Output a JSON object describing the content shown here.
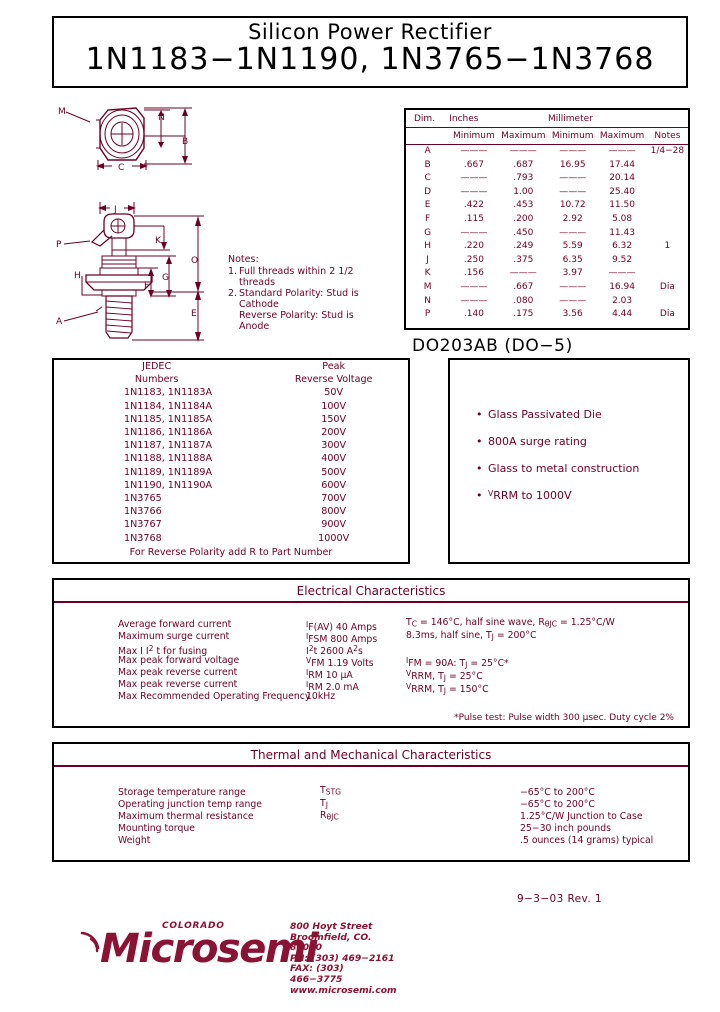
{
  "title": {
    "subtitle": "Silicon Power Rectifier",
    "main": "1N1183−1N1190, 1N3765−1N3768"
  },
  "package": {
    "label": "DO203AB (DO−5)"
  },
  "dimension_table": {
    "header_top": {
      "dim": "Dim.",
      "inches": "Inches",
      "millimeter": "Millimeter"
    },
    "header_sub": {
      "min_in": "Minimum",
      "max_in": "Maximum",
      "min_mm": "Minimum",
      "max_mm": "Maximum",
      "notes": "Notes"
    },
    "rows": [
      {
        "dim": "A",
        "min_in": "———",
        "max_in": "———",
        "min_mm": "———",
        "max_mm": "———",
        "notes": "1/4−28"
      },
      {
        "dim": "B",
        "min_in": ".667",
        "max_in": ".687",
        "min_mm": "16.95",
        "max_mm": "17.44",
        "notes": ""
      },
      {
        "dim": "C",
        "min_in": "———",
        "max_in": ".793",
        "min_mm": "———",
        "max_mm": "20.14",
        "notes": ""
      },
      {
        "dim": "D",
        "min_in": "———",
        "max_in": "1.00",
        "min_mm": "———",
        "max_mm": "25.40",
        "notes": ""
      },
      {
        "dim": "E",
        "min_in": ".422",
        "max_in": ".453",
        "min_mm": "10.72",
        "max_mm": "11.50",
        "notes": ""
      },
      {
        "dim": "F",
        "min_in": ".115",
        "max_in": ".200",
        "min_mm": "2.92",
        "max_mm": "5.08",
        "notes": ""
      },
      {
        "dim": "G",
        "min_in": "———",
        "max_in": ".450",
        "min_mm": "———",
        "max_mm": "11.43",
        "notes": ""
      },
      {
        "dim": "H",
        "min_in": ".220",
        "max_in": ".249",
        "min_mm": "5.59",
        "max_mm": "6.32",
        "notes": "1"
      },
      {
        "dim": "J",
        "min_in": ".250",
        "max_in": ".375",
        "min_mm": "6.35",
        "max_mm": "9.52",
        "notes": ""
      },
      {
        "dim": "K",
        "min_in": ".156",
        "max_in": "———",
        "min_mm": "3.97",
        "max_mm": "———",
        "notes": ""
      },
      {
        "dim": "M",
        "min_in": "———",
        "max_in": ".667",
        "min_mm": "———",
        "max_mm": "16.94",
        "notes": "Dia"
      },
      {
        "dim": "N",
        "min_in": "———",
        "max_in": ".080",
        "min_mm": "———",
        "max_mm": "2.03",
        "notes": ""
      },
      {
        "dim": "P",
        "min_in": ".140",
        "max_in": ".175",
        "min_mm": "3.56",
        "max_mm": "4.44",
        "notes": "Dia"
      }
    ]
  },
  "drawing": {
    "callouts": [
      "M",
      "N",
      "B",
      "C",
      "J",
      "P",
      "K",
      "O",
      "H",
      "G",
      "F",
      "E",
      "A"
    ]
  },
  "notes": {
    "heading": "Notes:",
    "items": [
      {
        "num": "1.",
        "text": "Full threads within 2 1/2 threads"
      },
      {
        "num": "2.",
        "text": "Standard Polarity: Stud is Cathode Reverse Polarity: Stud is Anode"
      }
    ],
    "item1_line1": "Full  threads  within  2 1/2",
    "item1_line2": "threads",
    "item2_line1": "Standard Polarity: Stud is",
    "item2_line2": "Cathode",
    "item2_line3": "Reverse Polarity: Stud is",
    "item2_line4": "Anode"
  },
  "jedec": {
    "header_left_line1": "JEDEC",
    "header_left_line2": "Numbers",
    "header_right_line1": "Peak",
    "header_right_line2": "Reverse  Voltage",
    "rows": [
      {
        "numbers": "1N1183, 1N1183A",
        "voltage": "50V"
      },
      {
        "numbers": "1N1184, 1N1184A",
        "voltage": "100V"
      },
      {
        "numbers": "1N1185, 1N1185A",
        "voltage": "150V"
      },
      {
        "numbers": "1N1186, 1N1186A",
        "voltage": "200V"
      },
      {
        "numbers": "1N1187, 1N1187A",
        "voltage": "300V"
      },
      {
        "numbers": "1N1188, 1N1188A",
        "voltage": "400V"
      },
      {
        "numbers": "1N1189, 1N1189A",
        "voltage": "500V"
      },
      {
        "numbers": "1N1190, 1N1190A",
        "voltage": "600V"
      },
      {
        "numbers": "1N3765",
        "voltage": "700V"
      },
      {
        "numbers": "1N3766",
        "voltage": "800V"
      },
      {
        "numbers": "1N3767",
        "voltage": "900V"
      },
      {
        "numbers": "1N3768",
        "voltage": "1000V"
      }
    ],
    "footnote": "For Reverse Polarity add R to Part Number"
  },
  "features": {
    "items": [
      "Glass Passivated Die",
      "800A surge rating",
      "Glass to metal construction",
      "V<sub>RRM</sub> to 1000V"
    ],
    "item1": "Glass Passivated Die",
    "item2": "800A surge rating",
    "item3": "Glass to metal construction",
    "item4_v": "V",
    "item4_sub": "RRM",
    "item4_rest": " to 1000V"
  },
  "electrical": {
    "title": "Electrical  Characteristics",
    "rows": [
      {
        "label": "Average forward current",
        "symbol": "IF(AV) 40 Amps",
        "condition": "TC = 146°C, half sine wave, RθJC = 1.25°C/W"
      },
      {
        "label": "Maximum surge current",
        "symbol": "IFSM  800 Amps",
        "condition": "8.3ms, half sine, TJ = 200°C"
      },
      {
        "label": "Max I 2 t for fusing",
        "symbol": "I2t 2600 A2s",
        "condition": ""
      },
      {
        "label": "Max peak forward voltage",
        "symbol": "VFM 1.19 Volts",
        "condition": "IFM = 90A: TJ = 25°C*"
      },
      {
        "label": "Max peak reverse current",
        "symbol": "IRM 10 µA",
        "condition": "VRRM, TJ = 25°C"
      },
      {
        "label": "Max peak reverse current",
        "symbol": "IRM 2.0 mA",
        "condition": "VRRM, TJ = 150°C"
      },
      {
        "label": "Max Recommended Operating Frequency",
        "symbol": "10kHz",
        "condition": ""
      }
    ],
    "labels": {
      "r1": "Average forward current",
      "r2": "Maximum surge current",
      "r3a": "Max I",
      "r3b": "t for fusing",
      "r4": "Max peak forward voltage",
      "r5": "Max peak reverse current",
      "r6": "Max peak reverse current",
      "r7": "Max Recommended Operating Frequency"
    },
    "symbols": {
      "s1_pre": "I",
      "s1_rest": "F(AV) 40 Amps",
      "s2_pre": "I",
      "s2_sub": "FSM",
      "s2_rest": "  800 Amps",
      "s3_pre": "I",
      "s3_sup": "2",
      "s3_mid": "t 2600 A",
      "s3_sup2": "2",
      "s3_end": "s",
      "s4_pre": "V",
      "s4_sub": "FM",
      "s4_rest": " 1.19 Volts",
      "s5_pre": "I",
      "s5_sub": "RM",
      "s5_rest": " 10 µA",
      "s6_pre": "I",
      "s6_sub": "RM",
      "s6_rest": " 2.0 mA",
      "s7": "10kHz"
    },
    "conditions": {
      "c1_a": "T",
      "c1_sub": "C",
      "c1_b": " = 146°C, half sine wave, R",
      "c1_sub2": "θJC",
      "c1_c": " = 1.25°C/W",
      "c2_a": "8.3ms, half sine, ",
      "c2_t": "T",
      "c2_sub": "J",
      "c2_b": " = 200°C",
      "c4_a": "I",
      "c4_sub": "FM",
      "c4_b": " = 90A: ",
      "c4_t": "T",
      "c4_sub2": "J",
      "c4_c": " = 25°C*",
      "c5_a": "V",
      "c5_sub": "RRM",
      "c5_b": ", ",
      "c5_t": "T",
      "c5_sub2": "J",
      "c5_c": " = 25°C",
      "c6_a": "V",
      "c6_sub": "RRM",
      "c6_b": ", ",
      "c6_t": "T",
      "c6_sub2": "J",
      "c6_c": " = 150°C"
    },
    "pulse_note": "*Pulse test: Pulse width 300 µsec. Duty cycle 2%"
  },
  "thermal": {
    "title": "Thermal  and  Mechanical  Characteristics",
    "rows": [
      {
        "label": "Storage temperature range",
        "symbol": "TSTG",
        "value": "−65°C to 200°C"
      },
      {
        "label": "Operating junction temp range",
        "symbol": "TJ",
        "value": "−65°C to 200°C"
      },
      {
        "label": "Maximum thermal resistance",
        "symbol": "RθJC",
        "value": "1.25°C/W Junction to Case"
      },
      {
        "label": "Mounting torque",
        "symbol": "",
        "value": "25−30 inch pounds"
      },
      {
        "label": "Weight",
        "symbol": "",
        "value": ".5 ounces (14 grams) typical"
      }
    ],
    "symbols": {
      "s1_pre": "T",
      "s1_sub": "STG",
      "s2_pre": "T",
      "s2_sub": "J",
      "s3_pre": "R",
      "s3_sub": "θJC"
    }
  },
  "footer": {
    "revision": "9−3−03   Rev. 1",
    "logo_word": "Microsemi",
    "logo_tag": "COLORADO",
    "address_line1": "800 Hoyt Street",
    "address_line2": "Broomfield, CO. 80020",
    "address_line3": "PH: (303) 469−2161",
    "address_line4": "FAX: (303) 466−3775",
    "address_line5": "www.microsemi.com"
  },
  "colors": {
    "maroon": "#6b0022",
    "logo": "#8a1233",
    "black": "#000000"
  }
}
